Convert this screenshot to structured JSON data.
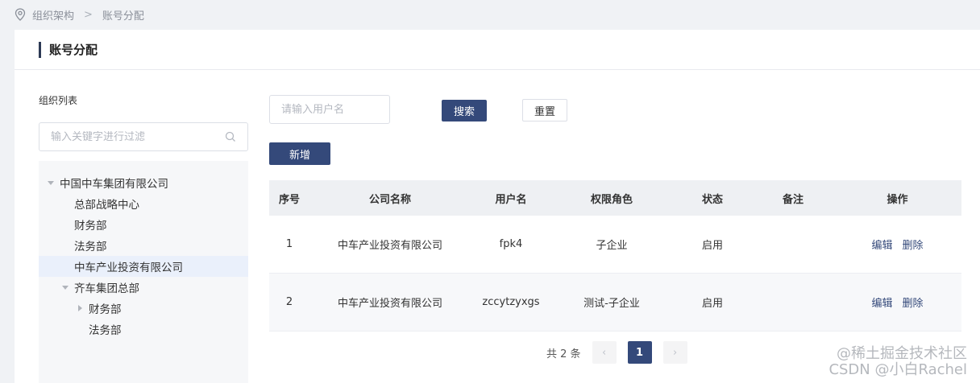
{
  "breadcrumb": {
    "items": [
      "组织架构",
      "账号分配"
    ],
    "separator": ">"
  },
  "page": {
    "title": "账号分配"
  },
  "left": {
    "label": "组织列表",
    "filter_placeholder": "输入关键字进行过滤",
    "tree": [
      {
        "label": "中国中车集团有限公司",
        "caret": "down",
        "level": 0
      },
      {
        "label": "总部战略中心",
        "caret": "none",
        "level": 1
      },
      {
        "label": "财务部",
        "caret": "none",
        "level": 1
      },
      {
        "label": "法务部",
        "caret": "none",
        "level": 1
      },
      {
        "label": "中车产业投资有限公司",
        "caret": "none",
        "level": 1,
        "active": true
      },
      {
        "label": "齐车集团总部",
        "caret": "down",
        "level": 1
      },
      {
        "label": "财务部",
        "caret": "right",
        "level": 2
      },
      {
        "label": "法务部",
        "caret": "none",
        "level": 2
      }
    ]
  },
  "toolbar": {
    "username_placeholder": "请输入用户名",
    "search_label": "搜索",
    "reset_label": "重置",
    "add_label": "新增"
  },
  "table": {
    "columns": [
      "序号",
      "公司名称",
      "用户名",
      "权限角色",
      "状态",
      "备注",
      "操作"
    ],
    "rows": [
      {
        "no": "1",
        "company": "中车产业投资有限公司",
        "username": "fpk4",
        "role": "子企业",
        "status": "启用",
        "remark": "",
        "edit": "编辑",
        "delete": "删除"
      },
      {
        "no": "2",
        "company": "中车产业投资有限公司",
        "username": "zccytzyxgs",
        "role": "测试-子企业",
        "status": "启用",
        "remark": "",
        "edit": "编辑",
        "delete": "删除"
      }
    ]
  },
  "pagination": {
    "total_text": "共 2 条",
    "current_page": "1",
    "prev": "‹",
    "next": "›"
  },
  "watermark": {
    "line1": "@稀土掘金技术社区",
    "line2": "CSDN @小白Rachel"
  },
  "colors": {
    "primary": "#34497a",
    "active_node": "#eaf0fb",
    "header_bg": "#eef0f3"
  }
}
